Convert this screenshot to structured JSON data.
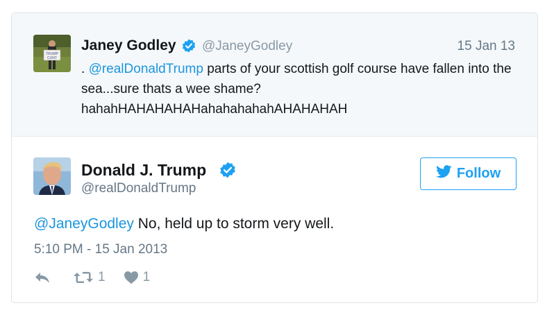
{
  "quoted_tweet": {
    "author_name": "Janey Godley",
    "author_handle": "@JaneyGodley",
    "date": "15 Jan 13",
    "text_prefix": ". ",
    "mention": "@realDonaldTrump",
    "text_body": " parts of your scottish golf course have fallen into the sea...sure thats a wee shame? hahahHAHAHAHAHahahahahahAHAHAHAH",
    "avatar_sign_text": "TRUMP CUNT"
  },
  "tweet": {
    "author_name": "Donald J. Trump",
    "author_handle": "@realDonaldTrump",
    "mention": "@JaneyGodley",
    "text_body": " No, held up to storm very well.",
    "timestamp": "5:10 PM - 15 Jan 2013",
    "retweet_count": "1",
    "like_count": "1"
  },
  "follow_button": {
    "label": "Follow"
  },
  "colors": {
    "link": "#1b95e0",
    "twitter_blue": "#1da1f2",
    "verified": "#1da1f2",
    "muted": "#8899a6"
  },
  "icons": [
    "verified-badge-icon",
    "twitter-bird-icon",
    "reply-icon",
    "retweet-icon",
    "heart-icon"
  ]
}
